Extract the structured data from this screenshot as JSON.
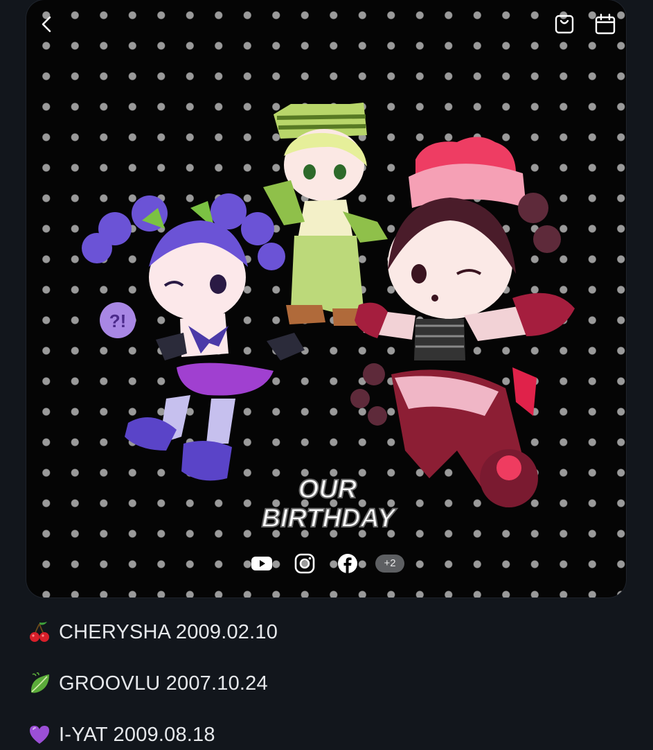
{
  "post": {
    "artwork_title": "OUR BIRTHDAY",
    "social": {
      "youtube_icon": "youtube-icon",
      "instagram_icon": "instagram-icon",
      "facebook_icon": "facebook-icon",
      "more_label": "+2"
    }
  },
  "toolbar": {
    "back_icon": "chevron-left-icon",
    "shop_icon": "shopping-bag-icon",
    "calendar_icon": "calendar-icon"
  },
  "members": [
    {
      "emoji": "cherry",
      "text": "CHERYSHA 2009.02.10"
    },
    {
      "emoji": "leaf",
      "text": "GROOVLU 2007.10.24"
    },
    {
      "emoji": "purple-heart",
      "text": "I-YAT 2009.08.18"
    }
  ],
  "colors": {
    "page_bg": "#12161c",
    "card_bg": "#050505",
    "dot": "#9a9a9a",
    "text": "#e6e8eb"
  }
}
